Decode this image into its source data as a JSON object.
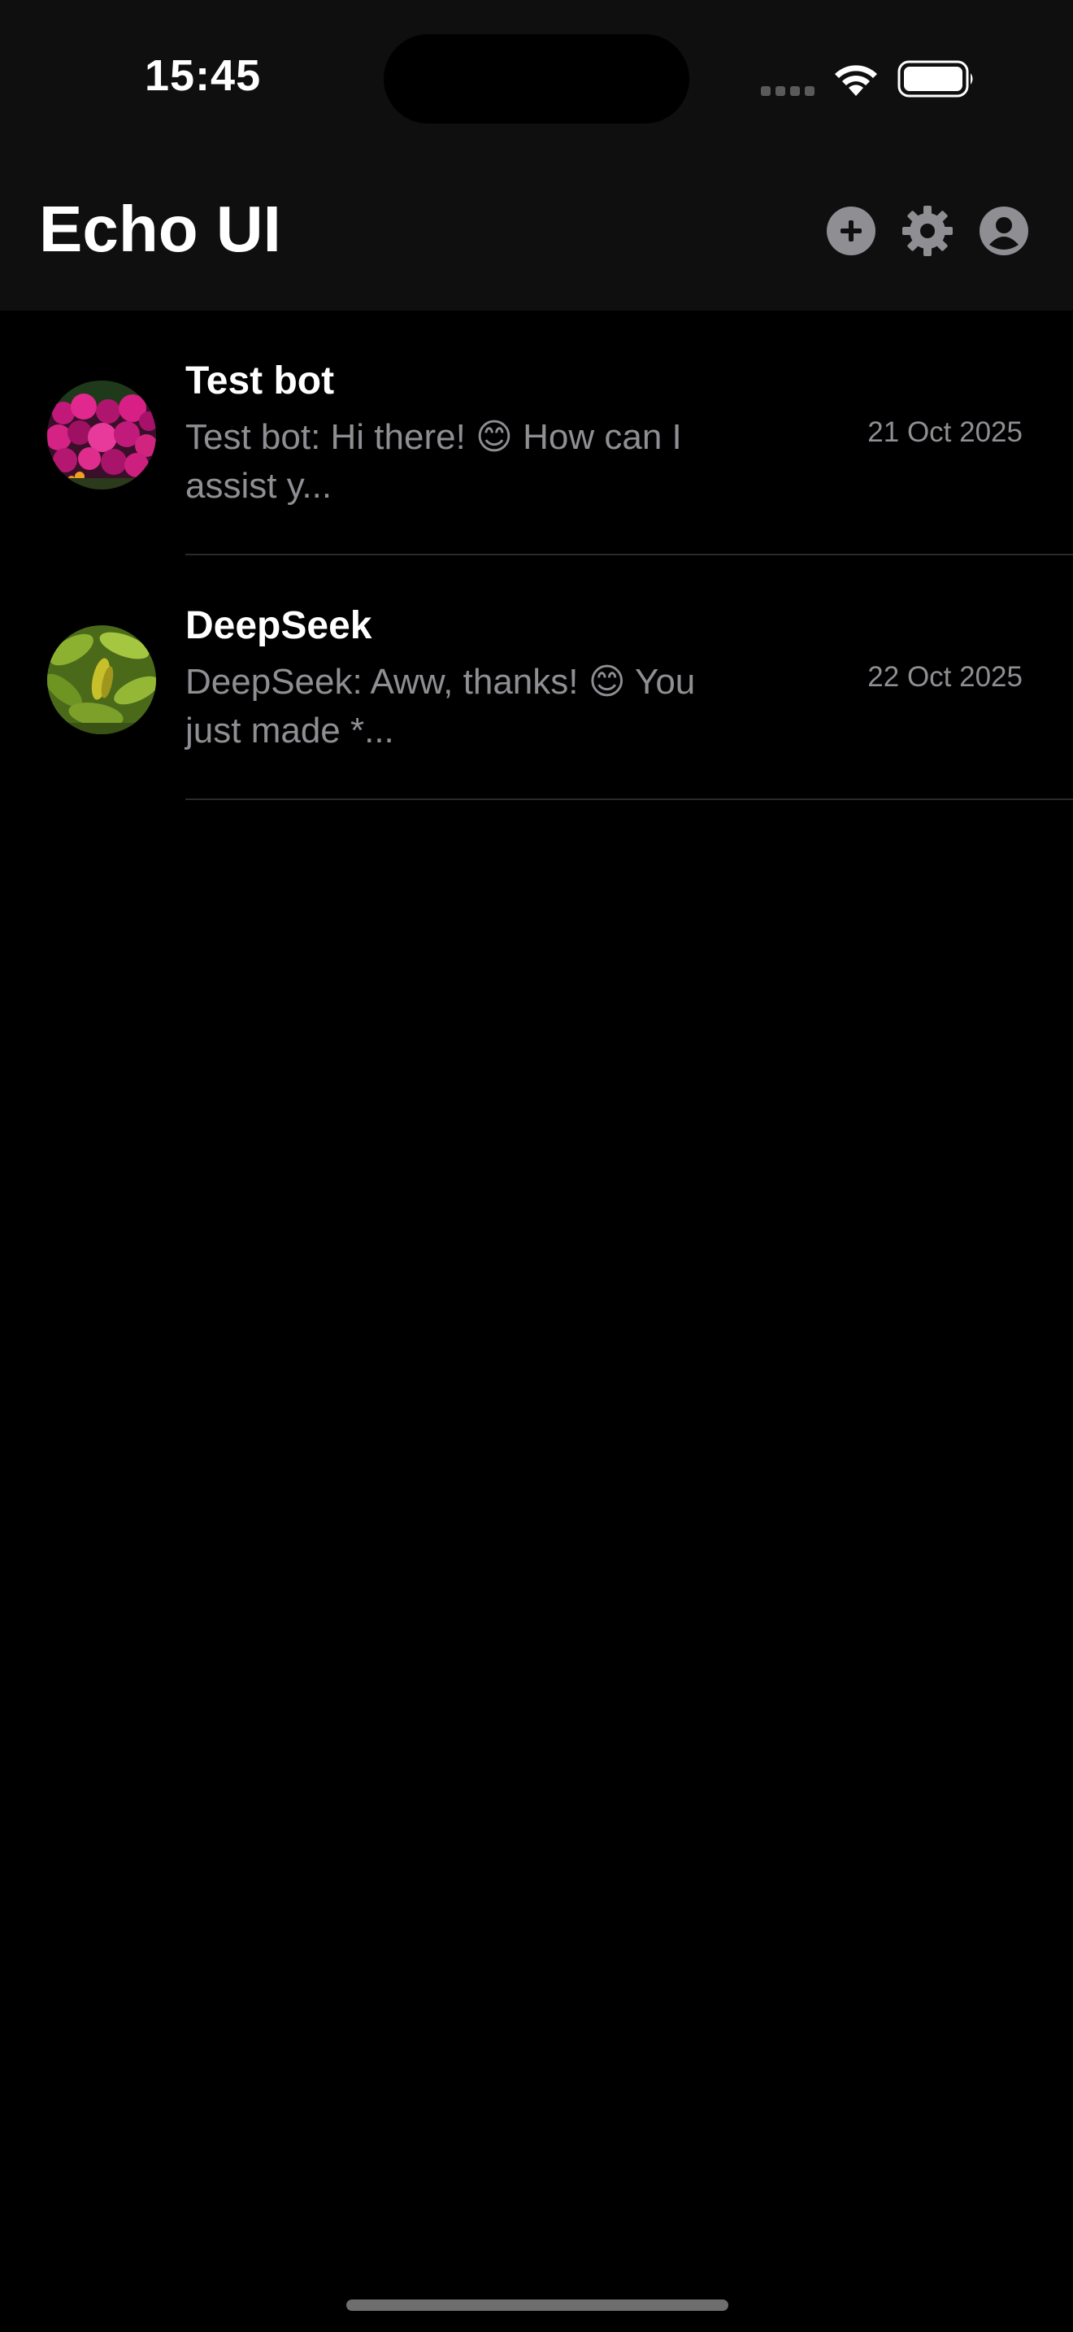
{
  "status_bar": {
    "time": "15:45",
    "icons": [
      "signal-icon",
      "wifi-icon",
      "battery-icon"
    ]
  },
  "header": {
    "title": "Echo UI",
    "actions": [
      {
        "name": "add-chat-button",
        "icon": "plus-circle-icon"
      },
      {
        "name": "settings-button",
        "icon": "gear-icon"
      },
      {
        "name": "profile-button",
        "icon": "person-circle-icon"
      }
    ]
  },
  "chats": [
    {
      "name": "Test bot",
      "preview": "Test bot: Hi there! 😊 How can I assist y...",
      "date": "21 Oct 2025",
      "avatar": "magenta-flowers-avatar"
    },
    {
      "name": "DeepSeek",
      "preview": "DeepSeek: Aww, thanks! 😊 You just made *...",
      "date": "22 Oct 2025",
      "avatar": "green-leaves-avatar"
    }
  ],
  "colors": {
    "background": "#000000",
    "bar_background": "#0f0f0f",
    "secondary_text": "#8e8e93",
    "icon_gray": "#8e8e93",
    "divider": "#2a2a2a"
  }
}
